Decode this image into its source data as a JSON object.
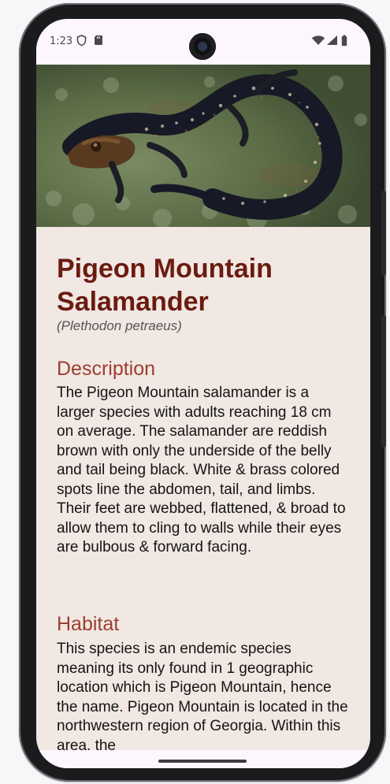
{
  "status_bar": {
    "time": "1:23"
  },
  "species": {
    "title": "Pigeon Mountain Salamander",
    "scientific_name": "(Plethodon petraeus)"
  },
  "sections": {
    "description": {
      "heading": "Description",
      "text": "The Pigeon Mountain salamander is a larger species with adults reaching 18 cm on average. The salamander are reddish brown with only the underside of the belly and tail being black. White & brass colored spots line the abdomen, tail, and limbs. Their feet are webbed, flattened, & broad to allow them to cling to walls while their eyes are bulbous & forward facing."
    },
    "habitat": {
      "heading": "Habitat",
      "text": "This species is an endemic species meaning its only found in 1 geographic location which is Pigeon Mountain, hence the name. Pigeon Mountain is located in the northwestern region of Georgia. Within this area, the"
    }
  },
  "icons": {
    "shield": "shield-icon",
    "sd_card": "sd-card-icon",
    "wifi": "wifi-icon",
    "signal": "signal-icon",
    "battery": "battery-icon"
  }
}
